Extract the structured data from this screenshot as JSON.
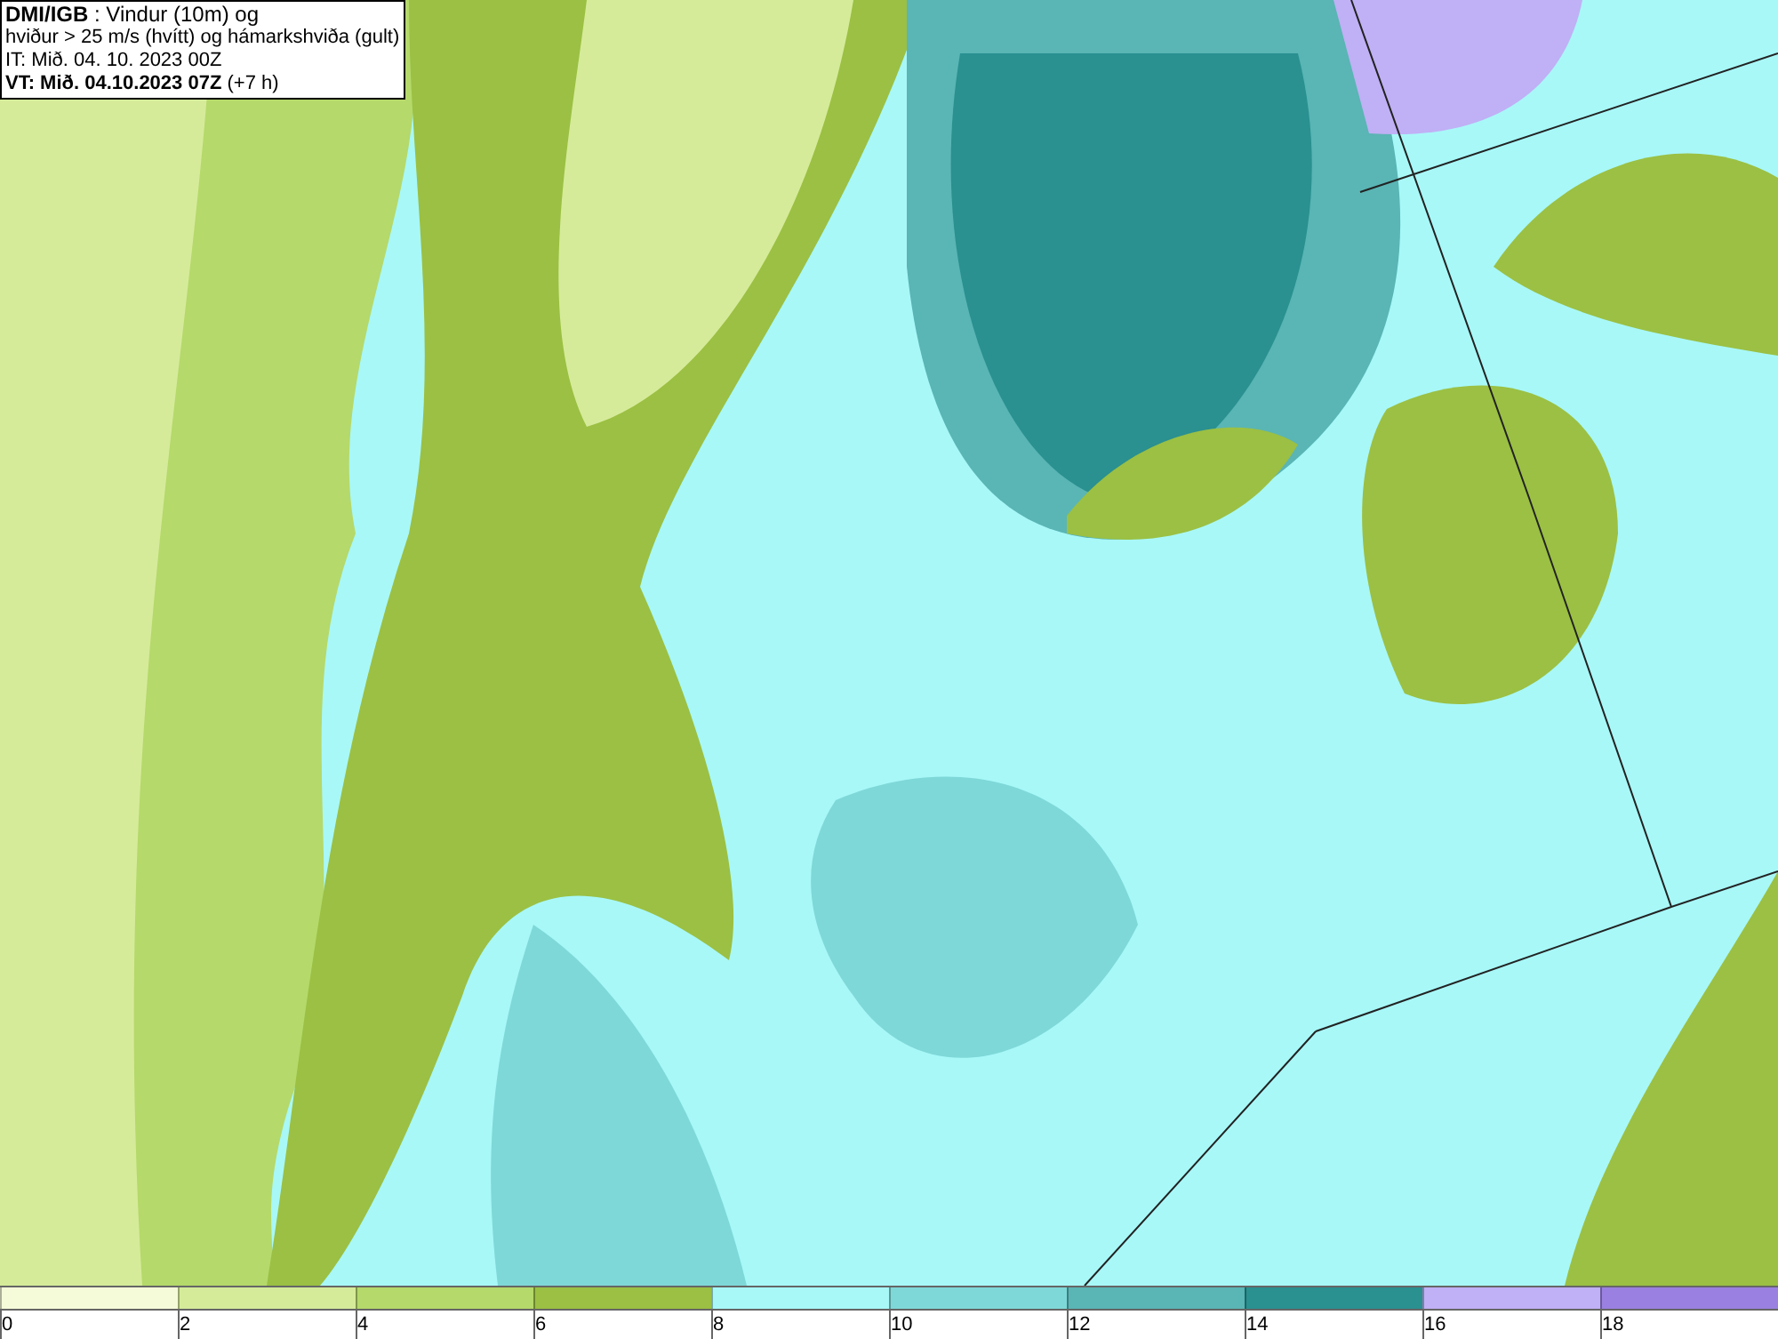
{
  "header": {
    "lines": [
      "**DMI/IGB** : Vindur (10m) og",
      "hviður > 25 m/s (hvítt) og hámarkshviða (gult)",
      "IT: Mið. 04. 10. 2023 00Z",
      "**VT: Mið. 04.10.2023 07Z** (+7 h)"
    ]
  },
  "legend": {
    "bins": [
      {
        "color": "#f5fbd9"
      },
      {
        "color": "#d5eb9a"
      },
      {
        "color": "#b5d96a"
      },
      {
        "color": "#9bc043"
      },
      {
        "color": "#a8f8f8"
      },
      {
        "color": "#7fd8d8"
      },
      {
        "color": "#5ab5b5"
      },
      {
        "color": "#2a9090"
      },
      {
        "color": "#c0b0f5"
      },
      {
        "color": "#9a80e0"
      }
    ],
    "labels": [
      "0",
      "2",
      "4",
      "6",
      "8",
      "10",
      "12",
      "14",
      "16",
      "18"
    ]
  }
}
